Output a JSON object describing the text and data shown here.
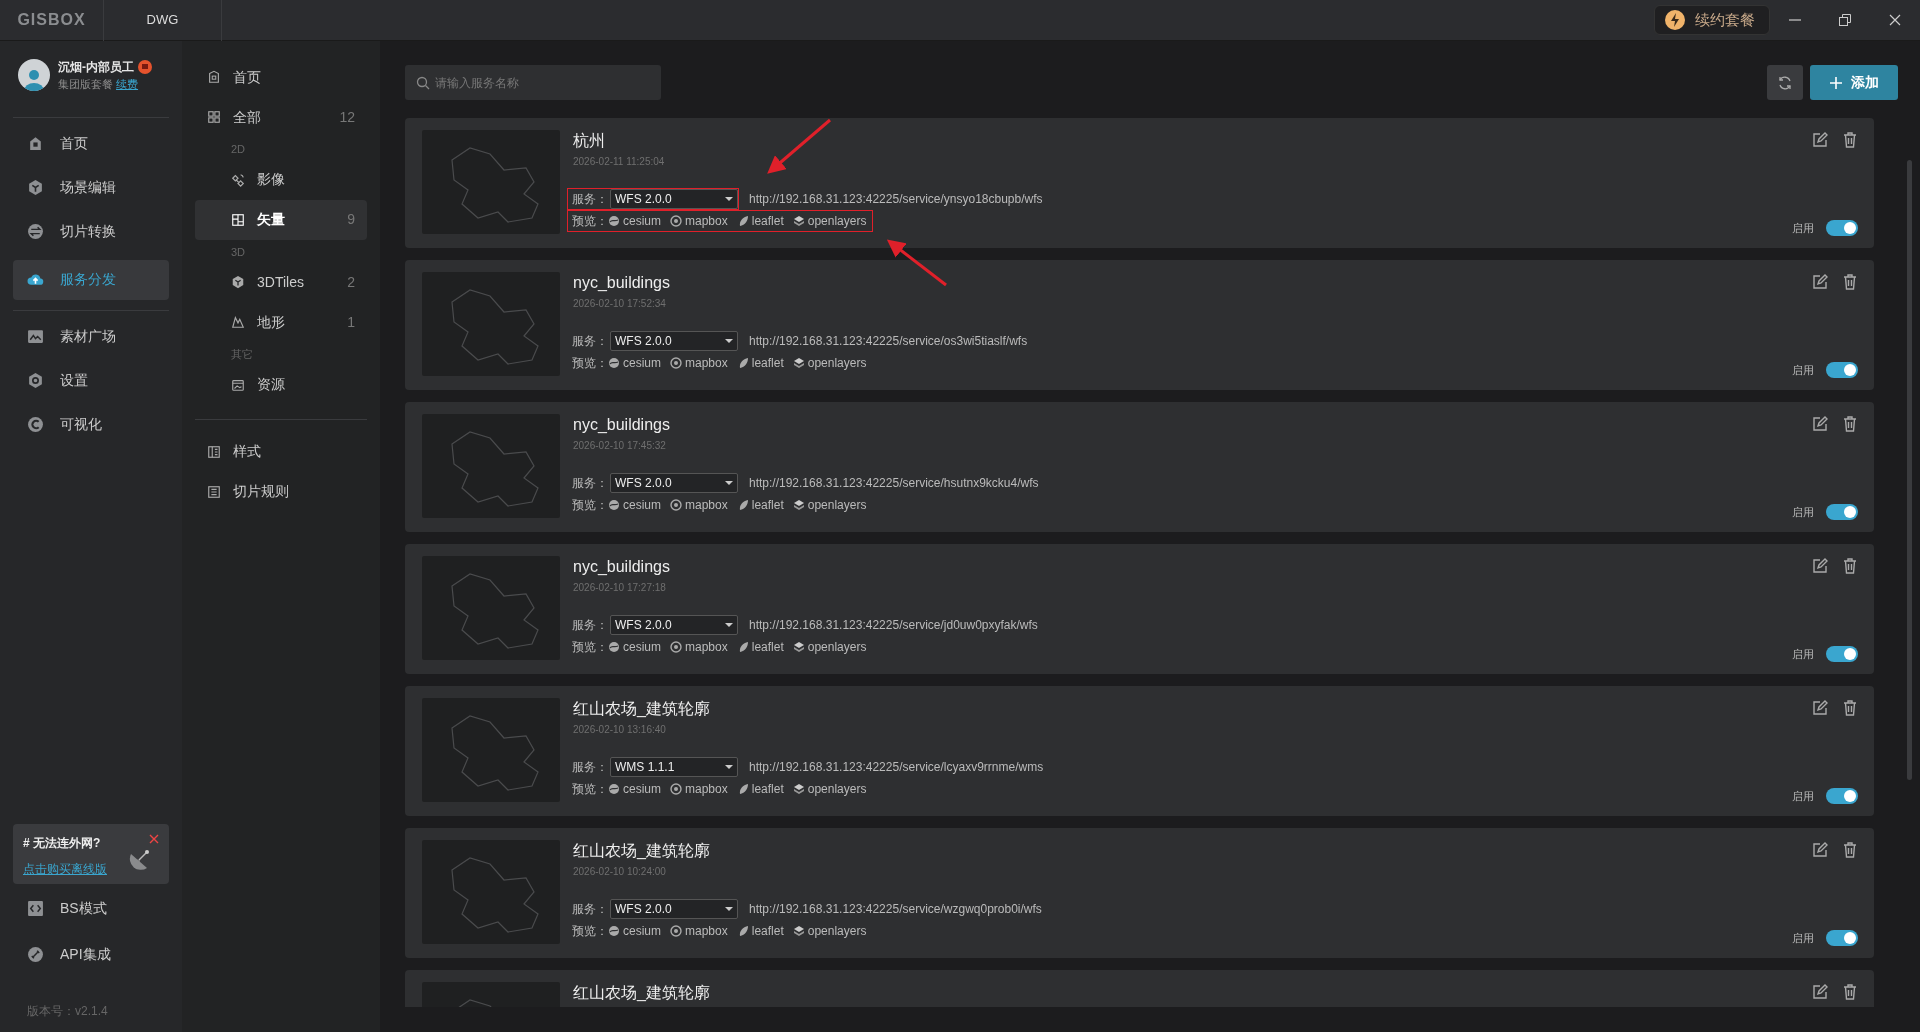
{
  "titlebar": {
    "logo": "GISBOX",
    "tab": "DWG",
    "renew_button": "续约套餐"
  },
  "user": {
    "name": "沉烟-内部员工",
    "plan": "集团版套餐",
    "renew_link": "续费"
  },
  "nav": [
    {
      "kind": "divider"
    },
    {
      "kind": "item",
      "label": "首页",
      "selected": false
    },
    {
      "kind": "item",
      "label": "场景编辑",
      "selected": false
    },
    {
      "kind": "item",
      "label": "切片转换",
      "selected": false
    },
    {
      "kind": "item",
      "label": "服务分发",
      "selected": true
    },
    {
      "kind": "divider"
    },
    {
      "kind": "item",
      "label": "素材广场",
      "selected": false
    },
    {
      "kind": "item",
      "label": "设置",
      "selected": false
    },
    {
      "kind": "item",
      "label": "可视化",
      "selected": false
    }
  ],
  "promo": {
    "title": "# 无法连外网?",
    "link": "点击购买离线版"
  },
  "bottom_nav": [
    {
      "label": "BS模式"
    },
    {
      "label": "API集成"
    }
  ],
  "version": "版本号：v2.1.4",
  "categories": [
    {
      "kind": "item",
      "label": "首页",
      "selected": false
    },
    {
      "kind": "item",
      "label": "全部",
      "count": "12",
      "selected": false
    },
    {
      "kind": "group",
      "label": "2D",
      "children": [
        {
          "kind": "item",
          "label": "影像",
          "selected": false
        },
        {
          "kind": "item",
          "label": "矢量",
          "count": "9",
          "selected": true
        }
      ]
    },
    {
      "kind": "group",
      "label": "3D",
      "children": [
        {
          "kind": "item",
          "label": "3DTiles",
          "count": "2",
          "selected": false
        },
        {
          "kind": "item",
          "label": "地形",
          "count": "1",
          "selected": false
        }
      ]
    },
    {
      "kind": "group",
      "label": "其它",
      "children": [
        {
          "kind": "item",
          "label": "资源",
          "selected": false
        }
      ]
    },
    {
      "kind": "divider"
    },
    {
      "kind": "item",
      "label": "样式",
      "selected": false
    },
    {
      "kind": "item",
      "label": "切片规则",
      "selected": false
    }
  ],
  "search": {
    "placeholder": "请输入服务名称"
  },
  "add_button": "添加",
  "services": [
    {
      "title": "杭州",
      "date": "2026-02-11 11:25:04",
      "service_label": "服务：",
      "service": "WFS 2.0.0",
      "url": "http://192.168.31.123:42225/service/ynsyo18cbupb/wfs",
      "preview_label": "预览：",
      "previews": [
        "cesium",
        "mapbox",
        "leaflet",
        "openlayers"
      ],
      "enable_label": "启用",
      "enabled": true,
      "annotated": true
    },
    {
      "title": "nyc_buildings",
      "date": "2026-02-10 17:52:34",
      "service_label": "服务：",
      "service": "WFS 2.0.0",
      "url": "http://192.168.31.123:42225/service/os3wi5tiaslf/wfs",
      "preview_label": "预览：",
      "previews": [
        "cesium",
        "mapbox",
        "leaflet",
        "openlayers"
      ],
      "enable_label": "启用",
      "enabled": true,
      "annotated": false
    },
    {
      "title": "nyc_buildings",
      "date": "2026-02-10 17:45:32",
      "service_label": "服务：",
      "service": "WFS 2.0.0",
      "url": "http://192.168.31.123:42225/service/hsutnx9kcku4/wfs",
      "preview_label": "预览：",
      "previews": [
        "cesium",
        "mapbox",
        "leaflet",
        "openlayers"
      ],
      "enable_label": "启用",
      "enabled": true,
      "annotated": false
    },
    {
      "title": "nyc_buildings",
      "date": "2026-02-10 17:27:18",
      "service_label": "服务：",
      "service": "WFS 2.0.0",
      "url": "http://192.168.31.123:42225/service/jd0uw0pxyfak/wfs",
      "preview_label": "预览：",
      "previews": [
        "cesium",
        "mapbox",
        "leaflet",
        "openlayers"
      ],
      "enable_label": "启用",
      "enabled": true,
      "annotated": false
    },
    {
      "title": "红山农场_建筑轮廓",
      "date": "2026-02-10 13:16:40",
      "service_label": "服务：",
      "service": "WMS 1.1.1",
      "url": "http://192.168.31.123:42225/service/lcyaxv9rrnme/wms",
      "preview_label": "预览：",
      "previews": [
        "cesium",
        "mapbox",
        "leaflet",
        "openlayers"
      ],
      "enable_label": "启用",
      "enabled": true,
      "annotated": false
    },
    {
      "title": "红山农场_建筑轮廓",
      "date": "2026-02-10 10:24:00",
      "service_label": "服务：",
      "service": "WFS 2.0.0",
      "url": "http://192.168.31.123:42225/service/wzgwq0prob0i/wfs",
      "preview_label": "预览：",
      "previews": [
        "cesium",
        "mapbox",
        "leaflet",
        "openlayers"
      ],
      "enable_label": "启用",
      "enabled": true,
      "annotated": false
    },
    {
      "title": "红山农场_建筑轮廓"
    }
  ]
}
